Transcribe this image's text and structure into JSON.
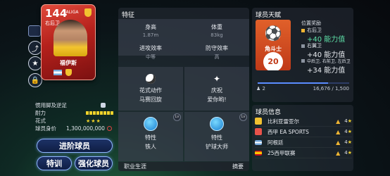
{
  "card": {
    "rating": "144",
    "league": "LALIGA",
    "position": "右后卫",
    "name": "福伊斯"
  },
  "left_info": {
    "foot_label": "惯用脚及逆足",
    "stamina_label": "耐力",
    "skill_label": "花式",
    "skill_stars": "★★★",
    "value_label": "球员身价",
    "value": "1,300,000,000"
  },
  "buttons": {
    "advance": "进阶球员",
    "train": "特训",
    "strengthen": "强化球员"
  },
  "traits": {
    "title": "特征",
    "height_label": "身高",
    "height_value": "1.87m",
    "weight_label": "体重",
    "weight_value": "83kg",
    "attack_label": "进攻效率",
    "attack_value": "中等",
    "defense_label": "防守效率",
    "defense_value": "高",
    "skill_move_label": "花式动作",
    "skill_move_value": "马赛回旋",
    "celebration_label": "庆祝",
    "celebration_value": "爱你哟!",
    "trait1_label": "特性",
    "trait1_value": "铁人",
    "trait2_label": "特性",
    "trait2_value": "铲球大师",
    "bottom_left": "职业生涯",
    "bottom_right": "摘要"
  },
  "talent": {
    "title": "球员天赋",
    "badge_role": "角斗士",
    "badge_level": "20",
    "reward_title": "位置奖励",
    "line1_pos": "右后卫",
    "line1_val": "+40 能力值",
    "line2_pos": "右翼卫",
    "line2_val": "+40 能力值",
    "line3_pos": "中后卫, 右前卫, 左后卫",
    "line3_val": "+34 能力值",
    "progress_fraction": 0.77,
    "foot_left": "2",
    "foot_right": "16,676 / 1,500"
  },
  "player_info": {
    "title": "球员信息",
    "rows": [
      {
        "name": "比利亚雷亚尔",
        "stars": "4"
      },
      {
        "name": "西甲 EA SPORTS",
        "stars": "4"
      },
      {
        "name": "阿根廷",
        "stars": "4"
      },
      {
        "name": "25西甲联赛",
        "stars": "4"
      }
    ]
  },
  "colors": {
    "accent": "#5fe0a8",
    "star": "#f0d32b",
    "card_red": "#b5211c",
    "talent_orange": "#e0602a"
  }
}
